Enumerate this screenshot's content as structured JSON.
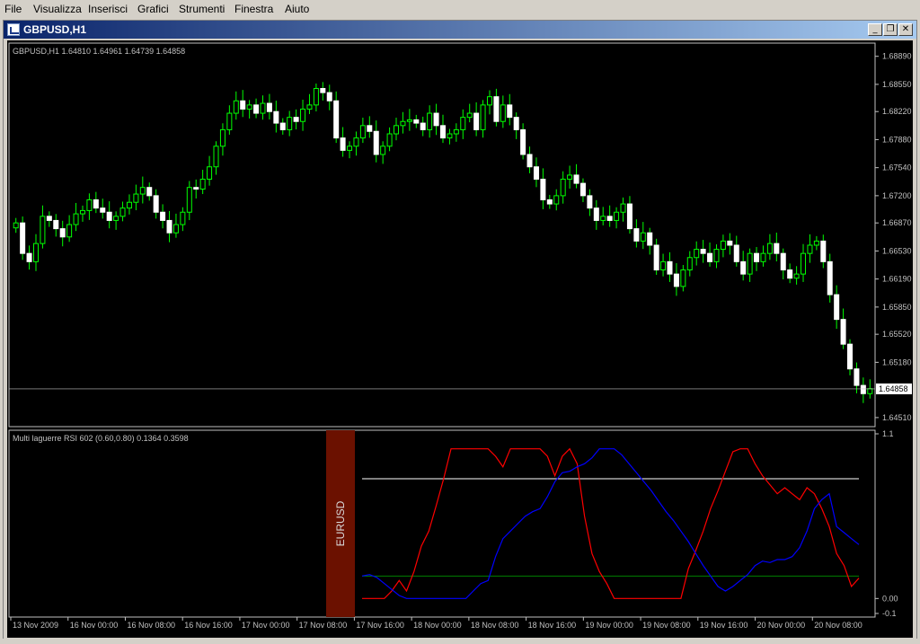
{
  "menu": {
    "items": [
      {
        "label": "File",
        "key": "F"
      },
      {
        "label": "Visualizza",
        "key": "V"
      },
      {
        "label": "Inserisci",
        "key": "I"
      },
      {
        "label": "Grafici",
        "key": "G"
      },
      {
        "label": "Strumenti",
        "key": "S"
      },
      {
        "label": "Finestra",
        "key": "F"
      },
      {
        "label": "Aiuto",
        "key": "A"
      }
    ]
  },
  "window": {
    "title": "GBPUSD,H1",
    "minimize_glyph": "_",
    "restore_glyph": "❐",
    "close_glyph": "✕"
  },
  "colors": {
    "background": "#000000",
    "axis": "#c0c0c0",
    "bull_candle": "#00ff00",
    "bear_candle": "#ffffff",
    "red_series": "#ff0000",
    "blue_series": "#0000ff",
    "level_high": "#ffffff",
    "level_low": "#008000",
    "label_bg": "#6b1100"
  },
  "chart_data": [
    {
      "type": "candlestick",
      "info": "GBPUSD,H1  1.64810 1.64961 1.64739 1.64858",
      "ylim": [
        1.644,
        1.6905
      ],
      "price_ticks": [
        "1.68890",
        "1.68550",
        "1.68220",
        "1.67880",
        "1.67540",
        "1.67200",
        "1.66870",
        "1.66530",
        "1.66190",
        "1.65850",
        "1.65520",
        "1.65180",
        "1.64510"
      ],
      "price_tick_values": [
        1.6889,
        1.6855,
        1.6822,
        1.6788,
        1.6754,
        1.672,
        1.6687,
        1.6653,
        1.6619,
        1.6585,
        1.6552,
        1.6518,
        1.6451
      ],
      "current_price": "1.64858",
      "current_price_value": 1.64858,
      "closes": [
        1.6687,
        1.665,
        1.664,
        1.6662,
        1.6695,
        1.669,
        1.668,
        1.667,
        1.6685,
        1.6698,
        1.6702,
        1.6715,
        1.6705,
        1.67,
        1.669,
        1.6695,
        1.6705,
        1.6712,
        1.6722,
        1.673,
        1.672,
        1.67,
        1.669,
        1.6675,
        1.6685,
        1.67,
        1.673,
        1.6728,
        1.674,
        1.6755,
        1.678,
        1.68,
        1.682,
        1.6835,
        1.6825,
        1.683,
        1.682,
        1.6832,
        1.6822,
        1.6808,
        1.68,
        1.6815,
        1.681,
        1.6825,
        1.683,
        1.685,
        1.6845,
        1.6835,
        1.679,
        1.6775,
        1.678,
        1.679,
        1.6805,
        1.6798,
        1.677,
        1.678,
        1.6795,
        1.6805,
        1.681,
        1.6812,
        1.6808,
        1.68,
        1.682,
        1.6805,
        1.679,
        1.6795,
        1.68,
        1.6815,
        1.682,
        1.68,
        1.683,
        1.684,
        1.681,
        1.683,
        1.6815,
        1.68,
        1.677,
        1.6755,
        1.674,
        1.6715,
        1.671,
        1.672,
        1.674,
        1.6745,
        1.6735,
        1.672,
        1.6705,
        1.669,
        1.6695,
        1.669,
        1.67,
        1.671,
        1.668,
        1.6665,
        1.6675,
        1.666,
        1.663,
        1.664,
        1.6625,
        1.661,
        1.663,
        1.6645,
        1.6655,
        1.665,
        1.664,
        1.6655,
        1.6665,
        1.666,
        1.664,
        1.6625,
        1.665,
        1.664,
        1.665,
        1.6662,
        1.665,
        1.663,
        1.662,
        1.6625,
        1.665,
        1.666,
        1.6665,
        1.664,
        1.66,
        1.657,
        1.654,
        1.651,
        1.649,
        1.648,
        1.6486
      ]
    },
    {
      "type": "line",
      "title": "Multi laguerre RSI 602 (0.60,0.80) 0.1364 0.3598",
      "symbol_label": "EURUSD",
      "ylim": [
        -0.1,
        1.1
      ],
      "y_ticks": [
        "1.1",
        "0.00",
        "-0.1"
      ],
      "y_tick_values": [
        1.1,
        0.0,
        -0.1
      ],
      "levels": [
        0.8,
        0.15
      ],
      "series": [
        {
          "color": "red",
          "values": [
            0.0,
            0.0,
            0.0,
            0.0,
            0.05,
            0.12,
            0.05,
            0.18,
            0.35,
            0.45,
            0.62,
            0.8,
            1.0,
            1.0,
            1.0,
            1.0,
            1.0,
            1.0,
            0.95,
            0.88,
            1.0,
            1.0,
            1.0,
            1.0,
            1.0,
            0.95,
            0.82,
            0.95,
            1.0,
            0.9,
            0.55,
            0.3,
            0.18,
            0.1,
            0.0,
            0.0,
            0.0,
            0.0,
            0.0,
            0.0,
            0.0,
            0.0,
            0.0,
            0.0,
            0.2,
            0.32,
            0.45,
            0.6,
            0.72,
            0.85,
            0.98,
            1.0,
            1.0,
            0.9,
            0.82,
            0.76,
            0.7,
            0.74,
            0.7,
            0.66,
            0.74,
            0.7,
            0.6,
            0.48,
            0.3,
            0.22,
            0.08,
            0.136
          ]
        },
        {
          "color": "blue",
          "values": [
            0.15,
            0.16,
            0.14,
            0.1,
            0.06,
            0.02,
            0.0,
            0.0,
            0.0,
            0.0,
            0.0,
            0.0,
            0.0,
            0.0,
            0.0,
            0.05,
            0.1,
            0.12,
            0.28,
            0.4,
            0.45,
            0.5,
            0.55,
            0.58,
            0.6,
            0.68,
            0.78,
            0.84,
            0.85,
            0.88,
            0.9,
            0.94,
            1.0,
            1.0,
            1.0,
            0.96,
            0.9,
            0.84,
            0.78,
            0.72,
            0.65,
            0.58,
            0.52,
            0.45,
            0.38,
            0.3,
            0.22,
            0.15,
            0.08,
            0.05,
            0.08,
            0.12,
            0.16,
            0.22,
            0.25,
            0.24,
            0.26,
            0.26,
            0.28,
            0.34,
            0.45,
            0.6,
            0.66,
            0.7,
            0.48,
            0.44,
            0.4,
            0.36
          ]
        }
      ]
    }
  ],
  "time_axis": [
    "13 Nov 2009",
    "16 Nov 00:00",
    "16 Nov 08:00",
    "16 Nov 16:00",
    "17 Nov 00:00",
    "17 Nov 08:00",
    "17 Nov 16:00",
    "18 Nov 00:00",
    "18 Nov 08:00",
    "18 Nov 16:00",
    "19 Nov 00:00",
    "19 Nov 08:00",
    "19 Nov 16:00",
    "20 Nov 00:00",
    "20 Nov 08:00"
  ]
}
